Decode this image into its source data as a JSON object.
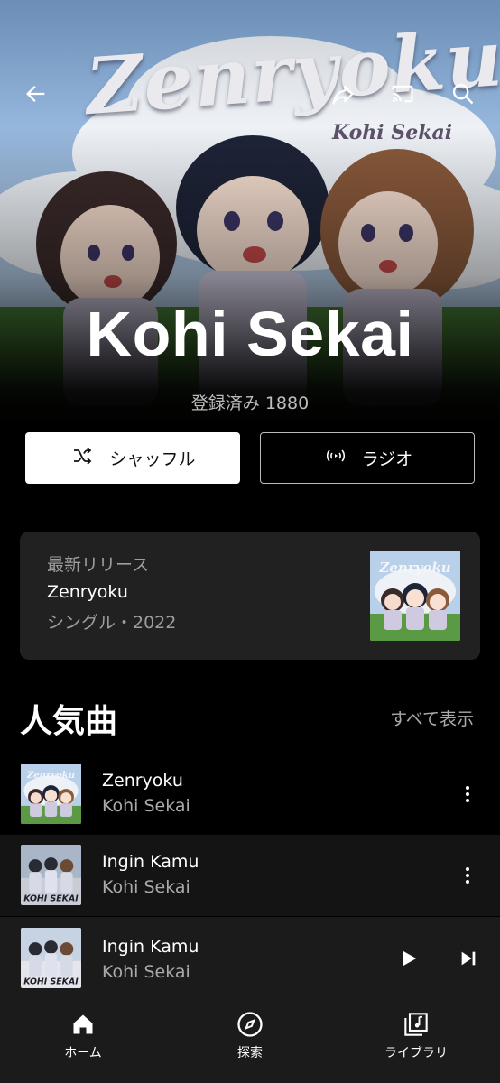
{
  "artist": {
    "name": "Kohi Sekai",
    "subscribers": "登録済み  1880",
    "banner": {
      "logo_title": "Zenryoku",
      "logo_subtitle": "Kohi Sekai"
    }
  },
  "header_icons": [
    "back-arrow-icon",
    "share-icon",
    "cast-icon",
    "search-icon"
  ],
  "actions": {
    "shuffle_label": "シャッフル",
    "radio_label": "ラジオ"
  },
  "latest_release": {
    "label": "最新リリース",
    "title": "Zenryoku",
    "meta": "シングル・2022",
    "cover_text": "Zenryoku"
  },
  "popular": {
    "title": "人気曲",
    "see_all": "すべて表示",
    "songs": [
      {
        "title": "Zenryoku",
        "artist": "Kohi Sekai",
        "cover_text": "Zenryoku"
      },
      {
        "title": "Ingin Kamu",
        "artist": "Kohi Sekai",
        "cover_text": "KOHI SEKAI"
      }
    ]
  },
  "now_playing": {
    "title": "Ingin Kamu",
    "artist": "Kohi Sekai",
    "cover_text": "KOHI SEKAI"
  },
  "nav": [
    {
      "label": "ホーム",
      "icon": "home-icon",
      "active": true
    },
    {
      "label": "探索",
      "icon": "compass-icon",
      "active": false
    },
    {
      "label": "ライブラリ",
      "icon": "library-icon",
      "active": false
    }
  ],
  "colors": {
    "background": "#000000",
    "card": "#212121",
    "player": "#1b1b1b",
    "secondary_text": "#aaaaaa"
  }
}
